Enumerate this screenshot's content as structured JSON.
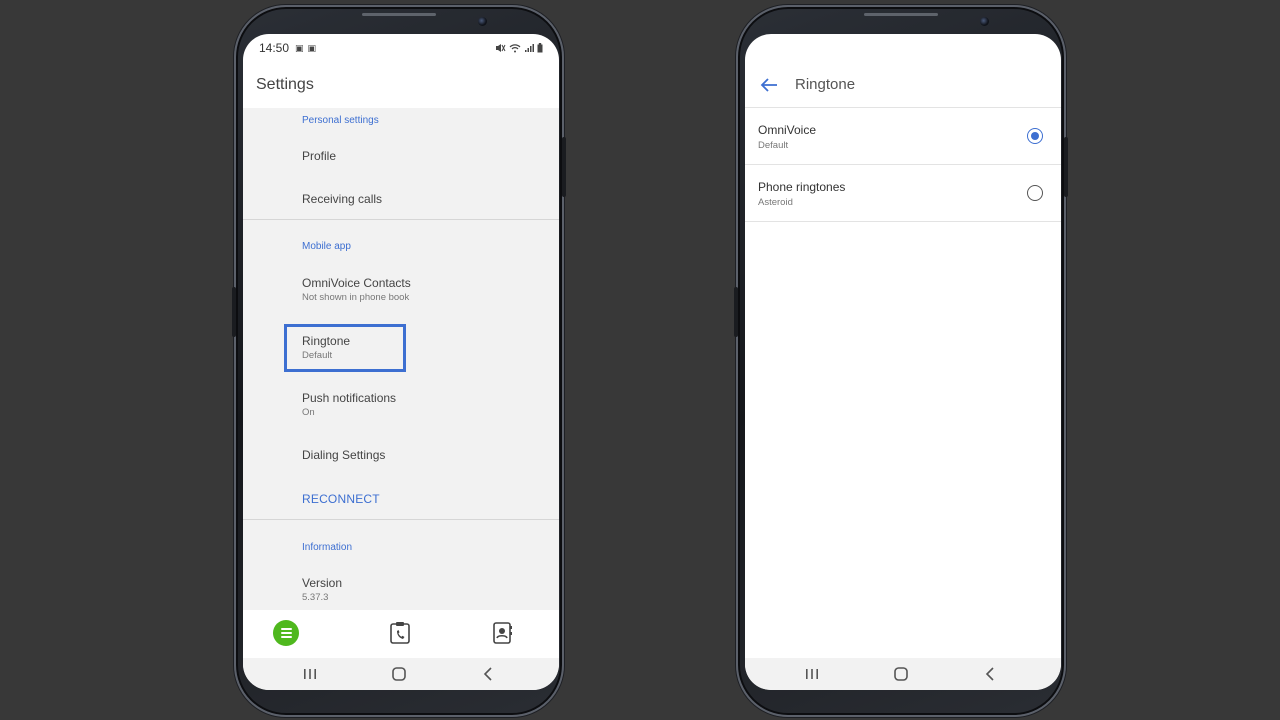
{
  "left_phone": {
    "status_bar": {
      "time": "14:50"
    },
    "header_title": "Settings",
    "sections": {
      "personal": {
        "header": "Personal settings",
        "items": [
          {
            "title": "Profile"
          },
          {
            "title": "Receiving calls"
          }
        ]
      },
      "mobile": {
        "header": "Mobile app",
        "items": [
          {
            "title": "OmniVoice Contacts",
            "sub": "Not shown in phone book"
          },
          {
            "title": "Ringtone",
            "sub": "Default"
          },
          {
            "title": "Push notifications",
            "sub": "On"
          },
          {
            "title": "Dialing Settings"
          }
        ],
        "action": "RECONNECT"
      },
      "information": {
        "header": "Information",
        "items": [
          {
            "title": "Version",
            "sub": "5.37.3"
          }
        ]
      }
    },
    "bottom_nav": {
      "menu_color": "#4fb81e",
      "icons": [
        "menu-icon",
        "call-history-icon",
        "contacts-icon"
      ]
    }
  },
  "right_phone": {
    "header_title": "Ringtone",
    "options": [
      {
        "title": "OmniVoice",
        "sub": "Default",
        "selected": true
      },
      {
        "title": "Phone ringtones",
        "sub": "Asteroid",
        "selected": false
      }
    ]
  },
  "colors": {
    "accent": "#3d6fd1",
    "background": "#383838",
    "list_bg": "#f2f2f2"
  }
}
